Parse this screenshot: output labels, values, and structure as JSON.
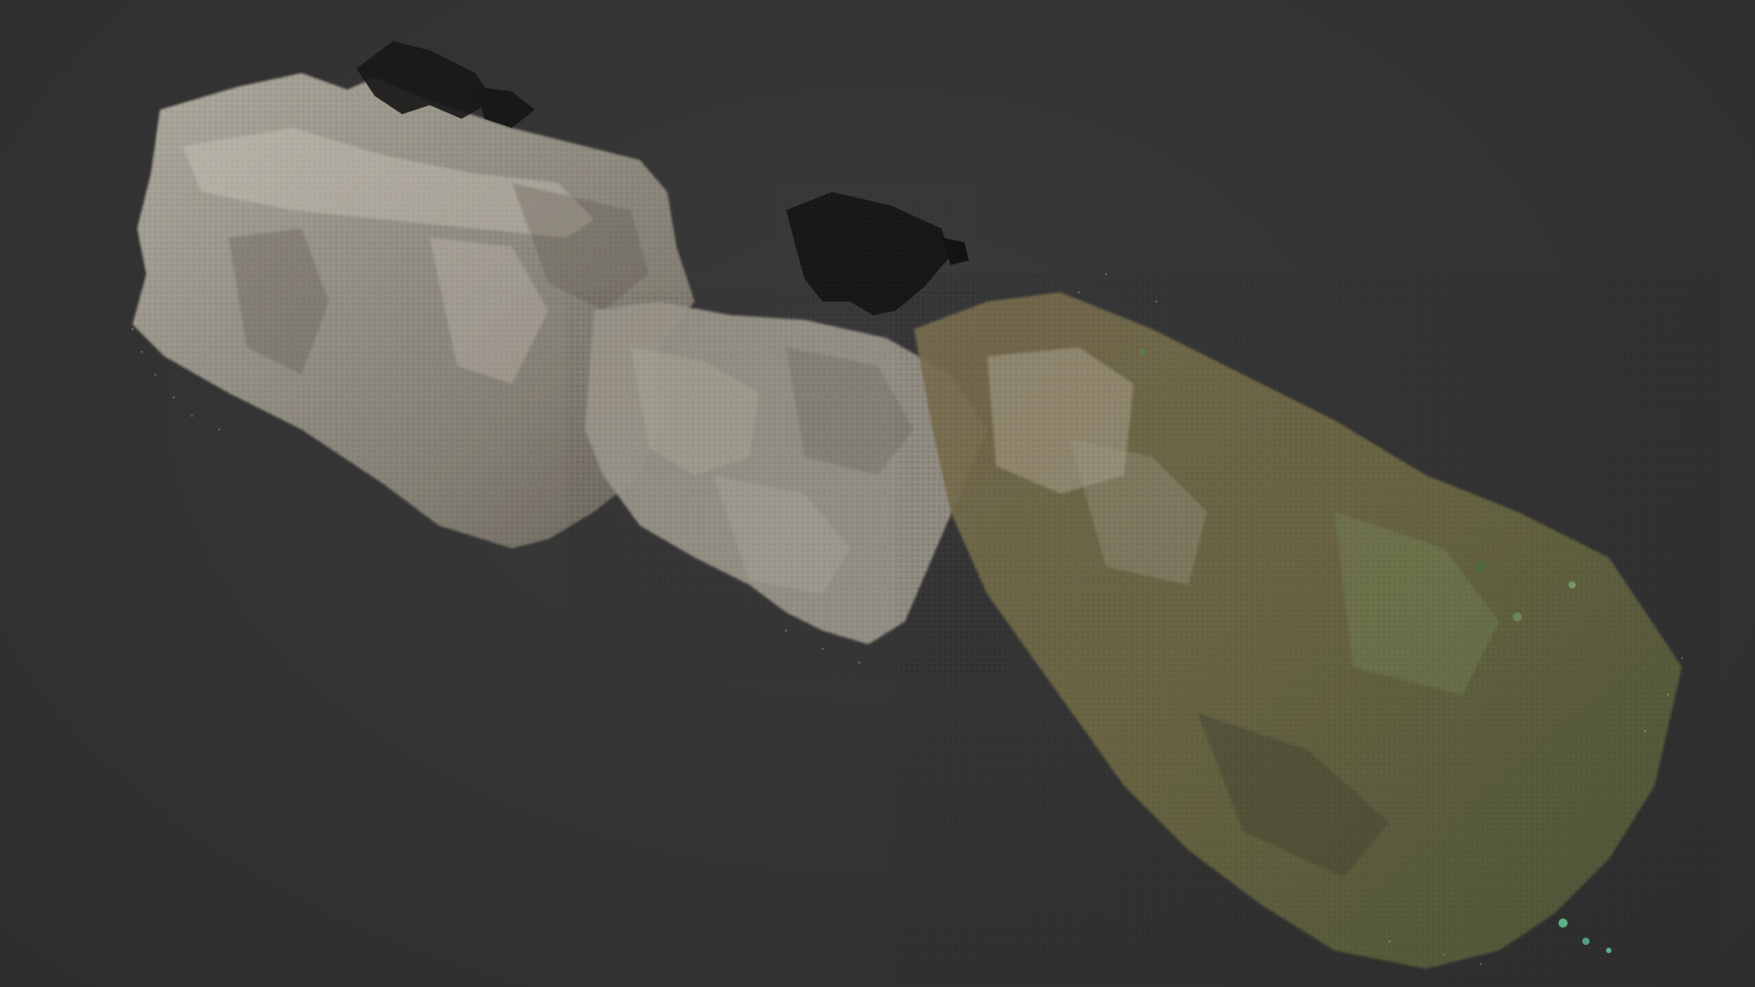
{
  "viewport": {
    "background_color": "#333333"
  },
  "point_cloud": {
    "subject": "rock-outcrop",
    "rock_colors": [
      "#b8b2a4",
      "#9d978a",
      "#cfc9ba",
      "#7e776b",
      "#e6e1d6",
      "#5f5a51"
    ],
    "shadow_color": "#2a2824",
    "vegetation_colors": [
      "#6b6a3c",
      "#7a6a45",
      "#5d7a4a",
      "#8aa86a",
      "#4f6b3b"
    ],
    "dark_fragment_color": "#151515",
    "accent_green": "#66c49a"
  }
}
